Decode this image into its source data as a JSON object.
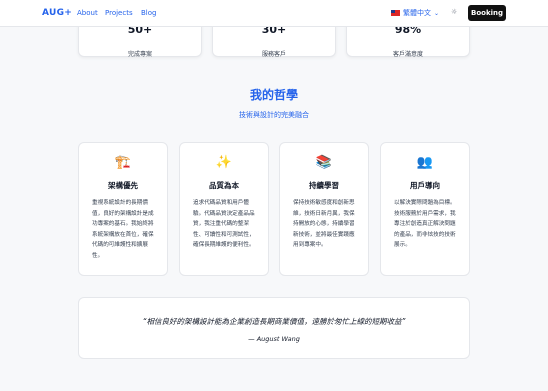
{
  "nav": {
    "logo": "AUG+",
    "links": [
      "About",
      "Projects",
      "Blog"
    ],
    "language": "繁體中文",
    "booking_label": "Booking"
  },
  "stats": [
    {
      "value": "50+",
      "label": "完成專案"
    },
    {
      "value": "30+",
      "label": "服務客戶"
    },
    {
      "value": "98%",
      "label": "客戶滿意度"
    }
  ],
  "philosophy": {
    "title": "我的哲學",
    "subtitle": "技術與設計的完美融合",
    "cards": [
      {
        "icon": "🏗️",
        "icon_name": "crane-icon",
        "title": "架構優先",
        "desc": "重視系統設計的長期價值，良好的架構設計是成功專案的基石。我始終將系統架構放在首位，確保代碼的可維護性和擴展性。"
      },
      {
        "icon": "✨",
        "icon_name": "sparkles-icon",
        "title": "品質為本",
        "desc": "追求代碼品質和用戶體驗。代碼品質決定產品品質，我注重代碼的整潔性、可讀性和可測試性，確保長期維護的便利性。"
      },
      {
        "icon": "📚",
        "icon_name": "books-icon",
        "title": "持續學習",
        "desc": "保持技術敏感度和創新思維，技術日新月異，我保持開放的心態，持續學習新技術，並將最佳實踐應用到專案中。"
      },
      {
        "icon": "👥",
        "icon_name": "users-icon",
        "title": "用戶導向",
        "desc": "以解決實際問題為目標。技術服務於用戶需求，我專注於創造真正解決問題的產品，而非炫技的技術展示。"
      }
    ]
  },
  "quote": {
    "text": "“相信良好的架構設計能為企業創造長期商業價值，遠勝於匆忙上線的短期收益”",
    "author": "— August Wang"
  },
  "colors": {
    "accent": "#2563eb",
    "booking_bg": "#111111",
    "background": "#f7f8fa"
  }
}
